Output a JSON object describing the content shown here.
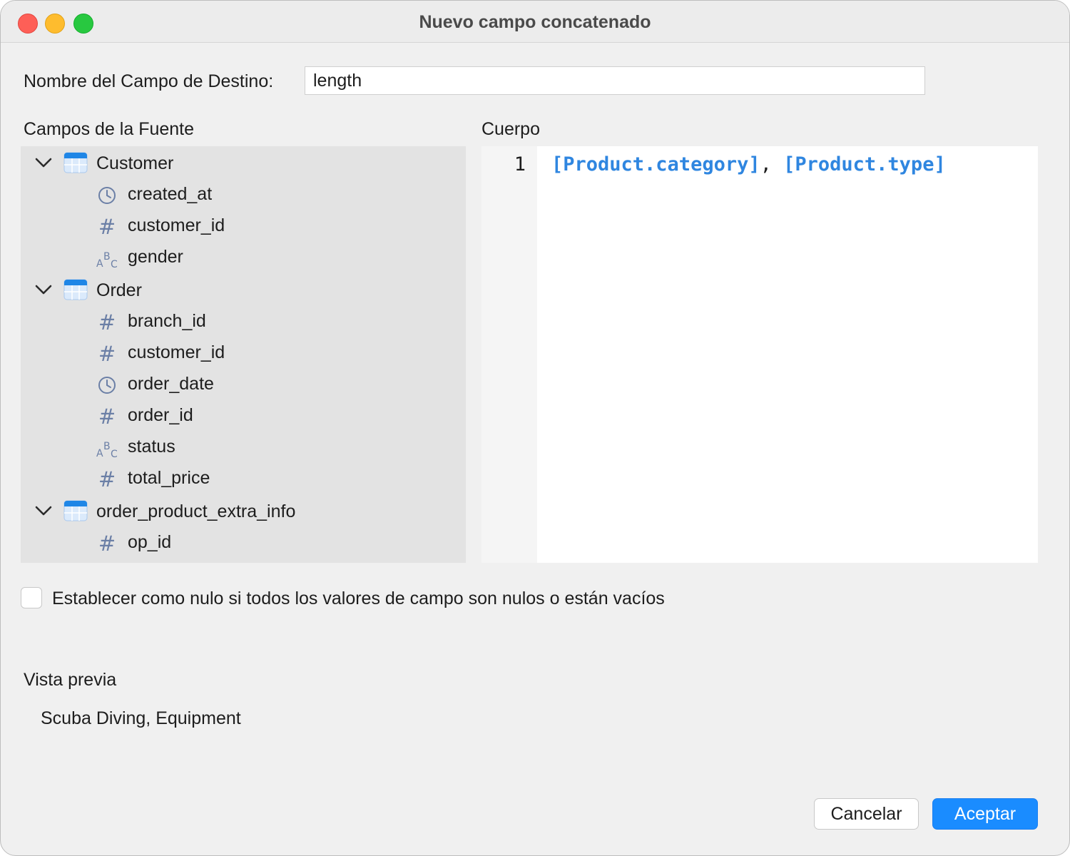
{
  "window": {
    "title": "Nuevo campo concatenado"
  },
  "target_field": {
    "label": "Nombre del Campo de Destino:",
    "value": "length"
  },
  "source_fields": {
    "label": "Campos de la Fuente",
    "tables": [
      {
        "name": "Customer",
        "fields": [
          {
            "name": "created_at",
            "type": "datetime"
          },
          {
            "name": "customer_id",
            "type": "number"
          },
          {
            "name": "gender",
            "type": "text"
          }
        ]
      },
      {
        "name": "Order",
        "fields": [
          {
            "name": "branch_id",
            "type": "number"
          },
          {
            "name": "customer_id",
            "type": "number"
          },
          {
            "name": "order_date",
            "type": "datetime"
          },
          {
            "name": "order_id",
            "type": "number"
          },
          {
            "name": "status",
            "type": "text"
          },
          {
            "name": "total_price",
            "type": "number"
          }
        ]
      },
      {
        "name": "order_product_extra_info",
        "fields": [
          {
            "name": "op_id",
            "type": "number"
          }
        ]
      }
    ]
  },
  "body": {
    "label": "Cuerpo",
    "line_number": "1",
    "token1": "[Product.category]",
    "separator": ", ",
    "token2": "[Product.type]"
  },
  "null_option": {
    "label": "Establecer como nulo si todos los valores de campo son nulos o están vacíos",
    "checked": false
  },
  "preview": {
    "label": "Vista previa",
    "value": "Scuba Diving, Equipment"
  },
  "buttons": {
    "cancel": "Cancelar",
    "ok": "Aceptar"
  },
  "colors": {
    "accent": "#1a8cff",
    "token": "#2f86e0",
    "icon": "#6b7fa6"
  }
}
